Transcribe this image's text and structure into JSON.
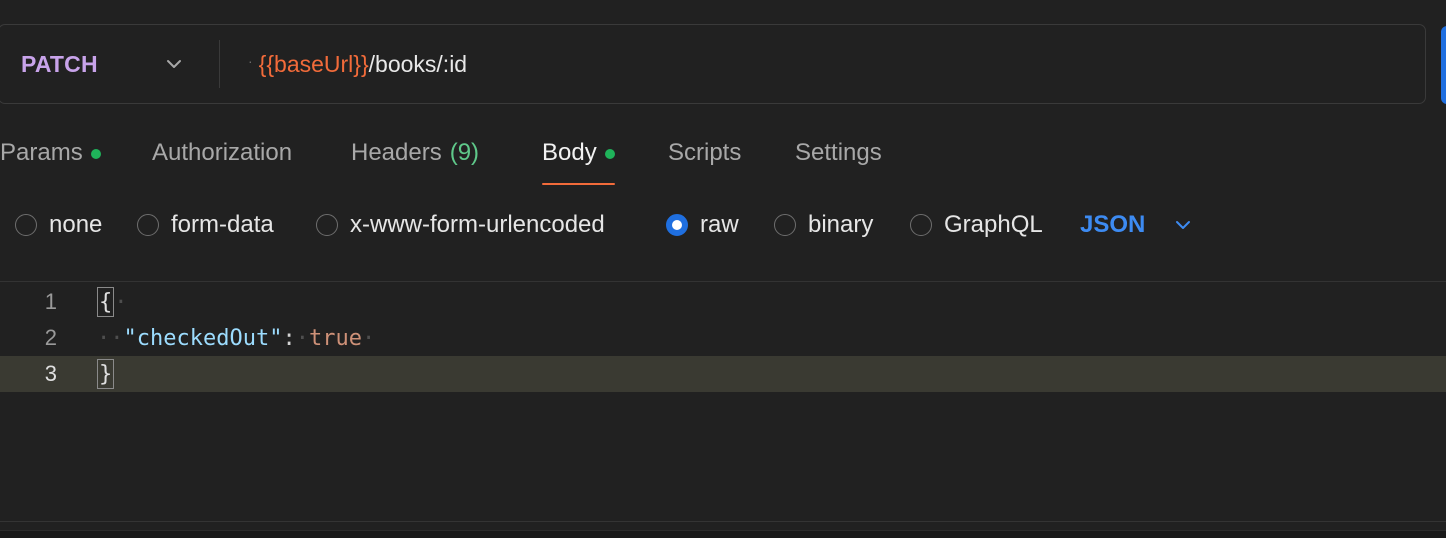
{
  "request": {
    "method": "PATCH",
    "url_variable": "{{baseUrl}}",
    "url_path": "/books/:id"
  },
  "tabs": [
    {
      "label": "Params",
      "indicator_dot": true
    },
    {
      "label": "Authorization"
    },
    {
      "label": "Headers",
      "count": "(9)"
    },
    {
      "label": "Body",
      "indicator_dot": true,
      "active": true
    },
    {
      "label": "Scripts"
    },
    {
      "label": "Settings"
    }
  ],
  "body_types": [
    {
      "label": "none",
      "selected": false
    },
    {
      "label": "form-data",
      "selected": false
    },
    {
      "label": "x-www-form-urlencoded",
      "selected": false
    },
    {
      "label": "raw",
      "selected": true
    },
    {
      "label": "binary",
      "selected": false
    },
    {
      "label": "GraphQL",
      "selected": false
    }
  ],
  "format": "JSON",
  "editor": {
    "line_numbers": [
      "1",
      "2",
      "3"
    ],
    "open_brace": "{",
    "close_brace": "}",
    "key": "\"checkedOut\"",
    "colon": ":",
    "value": "true",
    "current_line": 3
  },
  "colors": {
    "method": "#c8a3ea",
    "url_variable": "#f26b3a",
    "active_tab_underline": "#f26b3a",
    "indicator_dot": "#1fb35a",
    "radio_selected": "#1f6fe0",
    "format_label": "#3d8bf2",
    "json_key": "#9cdcfe",
    "json_value": "#ce9178"
  },
  "icons": {
    "method_dropdown": "chevron-down-icon",
    "format_dropdown": "chevron-down-icon"
  }
}
